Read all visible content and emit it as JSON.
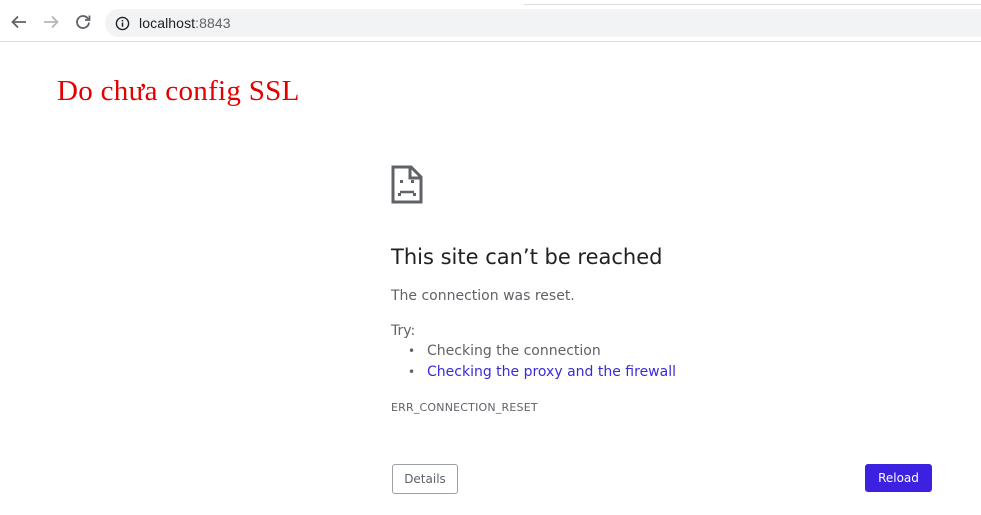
{
  "browser": {
    "url_host": "localhost",
    "url_port": ":8843",
    "icons": {
      "back": "arrow-left-icon",
      "forward": "arrow-right-icon",
      "reload": "reload-icon",
      "site_info": "info-icon"
    }
  },
  "annotation": {
    "text": "Do chưa config SSL",
    "color": "#e50000"
  },
  "error_page": {
    "icon": "sad-page-icon",
    "heading": "This site can’t be reached",
    "summary": "The connection was reset.",
    "try_label": "Try:",
    "suggestions": [
      {
        "text": "Checking the connection",
        "is_link": false
      },
      {
        "text": "Checking the proxy and the firewall",
        "is_link": true
      }
    ],
    "error_code": "ERR_CONNECTION_RESET",
    "details_label": "Details",
    "reload_label": "Reload",
    "colors": {
      "accent": "#3d21e0",
      "link": "#3a2bd9",
      "secondary_text": "#5f6368"
    }
  }
}
